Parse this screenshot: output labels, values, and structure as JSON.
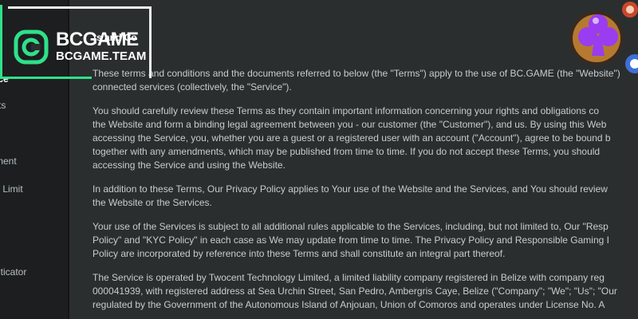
{
  "logo": {
    "brand": "BCGAME",
    "domain": "BCGAME.TEAM"
  },
  "sidebar": {
    "items": [
      {
        "label": "ice"
      },
      {
        "label": "rts"
      },
      {
        "label": "ment"
      },
      {
        "label": "y Limit"
      },
      {
        "label": "nticator"
      }
    ]
  },
  "main": {
    "heading": "ts and Co",
    "paragraphs": [
      [
        "These terms and conditions and the documents referred to below (the \"Terms\") apply to the use of BC.GAME (the \"Website\")",
        "connected services (collectively, the \"Service\")."
      ],
      [
        "You should carefully review these Terms as they contain important information concerning your rights and obligations co",
        "the Website and form a binding legal agreement between you - our customer (the \"Customer\"), and us. By using this Web",
        "accessing the Service, you, whether you are a guest or a registered user with an account (\"Account\"), agree to be bound b",
        "together with any amendments, which may be published from time to time. If you do not accept these Terms, you should",
        "accessing the Service and using the Website."
      ],
      [
        "In addition to these Terms, Our Privacy Policy applies to Your use of the Website and the Services, and You should review",
        "the Website or the Services."
      ],
      [
        "Your use of the Services is subject to all additional rules applicable to the Services, including, but not limited to, Our \"Resp",
        "Policy\" and \"KYC Policy\" in each case as We may update from time to time. The Privacy Policy and Responsible Gaming I",
        "Policy are incorporated by reference into these Terms and shall constitute an integral part thereof."
      ],
      [
        "The Service is operated by Twocent Technology Limited, a limited liability company registered in Belize with company reg",
        "000041939, with registered address at Sea Urchin Street, San Pedro, Ambergris Caye, Belize (\"Company\"; \"We\"; \"Us\"; \"Our",
        "regulated by the Government of the Autonomous Island of Anjouan, Union of Comoros and operates under License No. A"
      ]
    ]
  },
  "colors": {
    "accent": "#2fe08a",
    "background": "#2b2e2e",
    "sidebar": "#1c1e1f",
    "club": "#9a3cf0"
  }
}
